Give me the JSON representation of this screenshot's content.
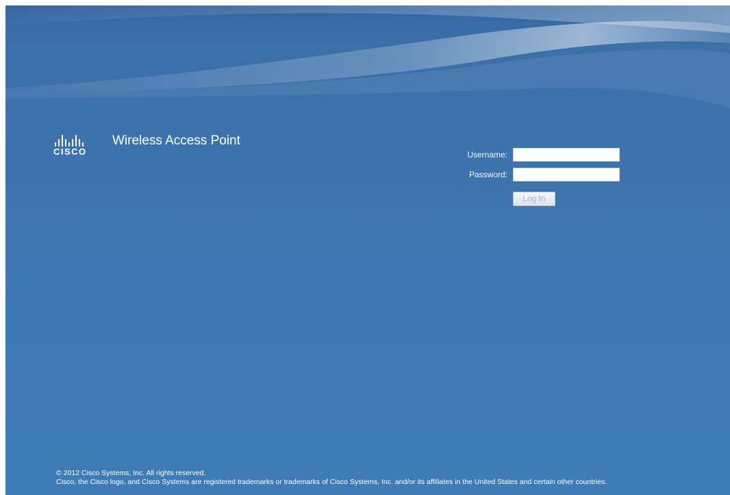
{
  "header": {
    "brand": "CISCO",
    "product_title": "Wireless Access Point"
  },
  "login": {
    "username_label": "Username:",
    "username_value": "",
    "password_label": "Password:",
    "password_value": "",
    "submit_label": "Log In"
  },
  "footer": {
    "copyright": "© 2012 Cisco Systems, Inc. All rights reserved.",
    "trademark": "Cisco, the Cisco logo, and Cisco Systems are registered trademarks or trademarks of Cisco Systems, Inc. and/or its affiliates in the United States and certain other countries."
  },
  "colors": {
    "background": "#3f78b2",
    "text": "#ffffff",
    "button_text_disabled": "#a9b2bc"
  },
  "icons": {
    "logo": "cisco-logo-icon"
  }
}
